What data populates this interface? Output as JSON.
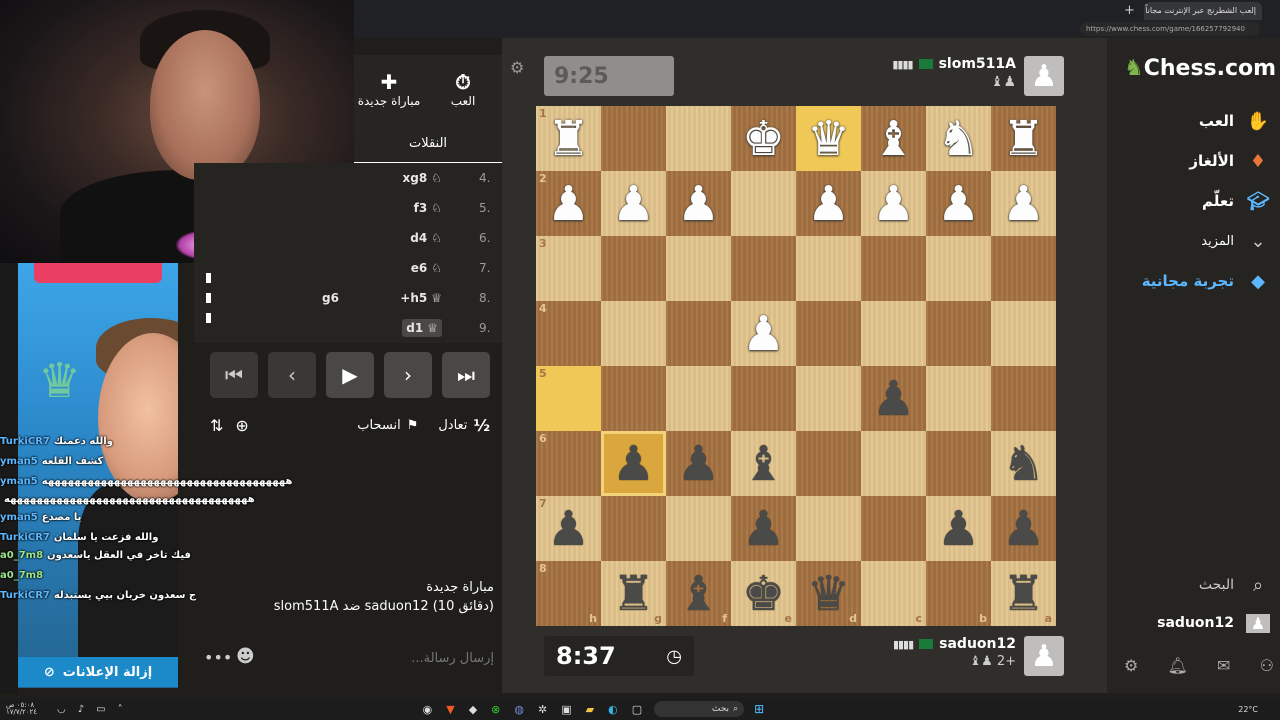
{
  "browser": {
    "tab_title": "إلعب الشطرنج عبر الإنترنت مجاناً - ش",
    "url": "https://www.chess.com/game/166257792940",
    "new_tab": "+"
  },
  "stream": {
    "ad_remove_label": "إزالة الإعلانات",
    "chat": [
      {
        "user": "TurkiCR7",
        "text": "والله دعمنك",
        "color": "blue"
      },
      {
        "user": "yman5",
        "text": "كشف القلعه",
        "color": "blue"
      },
      {
        "user": "yman5",
        "text": "هههههههههههههههههههههههههههههههههههههه",
        "color": "blue"
      },
      {
        "user": "",
        "text": "هههههههههههههههههههههههههههههههههههههه",
        "color": "blue"
      },
      {
        "user": "yman5",
        "text": "يا مصدع",
        "color": "blue"
      },
      {
        "user": "TurkiCR7",
        "text": "والله فزعت يا سلمان",
        "color": "blue"
      },
      {
        "user": "a0_7m8",
        "text": "فيك تاخر في العقل ياسعدون",
        "color": "green"
      },
      {
        "user": "a0_7m8",
        "text": "",
        "color": "green"
      },
      {
        "user": "TurkiCR7",
        "text": "ج سعدون خربان بيي يستبدله",
        "color": "blue"
      }
    ]
  },
  "game_panel": {
    "play_label": "العب",
    "new_game_label": "مباراة جديدة",
    "moves_tab": "النقلات",
    "moves": [
      {
        "num": "4.",
        "white": "xg8",
        "black": ""
      },
      {
        "num": "5.",
        "white": "f3",
        "black": ""
      },
      {
        "num": "6.",
        "white": "d4",
        "black": ""
      },
      {
        "num": "7.",
        "white": "e6",
        "black": ""
      },
      {
        "num": "8.",
        "white": "+h5",
        "black": "g6"
      },
      {
        "num": "9.",
        "white": "d1",
        "black": ""
      }
    ],
    "draw_label": "تعادل",
    "resign_label": "انسحاب",
    "draw_symbol": "½",
    "game_title": "مباراة جديدة",
    "game_desc": "slom511A ضد saduon12 (10 دقائق)",
    "chat_placeholder": "إرسال رسالة..."
  },
  "board": {
    "top_player": "slom511A",
    "bottom_player": "saduon12",
    "top_clock": "9:25",
    "bottom_clock": "8:37",
    "bottom_material": "2+",
    "ranks": [
      "1",
      "2",
      "3",
      "4",
      "5",
      "6",
      "7",
      "8"
    ],
    "files": [
      "h",
      "g",
      "f",
      "e",
      "d",
      "c",
      "b",
      "a"
    ],
    "rows": [
      [
        "wR",
        "",
        "",
        "wK",
        "wQ",
        "wB",
        "wN",
        "wR"
      ],
      [
        "wP",
        "wP",
        "wP",
        "",
        "wP",
        "wP",
        "wP",
        "wP"
      ],
      [
        "",
        "",
        "",
        "",
        "",
        "",
        "",
        ""
      ],
      [
        "",
        "",
        "",
        "wP",
        "",
        "",
        "",
        ""
      ],
      [
        "",
        "",
        "",
        "",
        "",
        "bP",
        "",
        ""
      ],
      [
        "",
        "bP",
        "bP",
        "bB",
        "",
        "",
        "",
        "bN"
      ],
      [
        "bP",
        "",
        "",
        "bP",
        "",
        "",
        "bP",
        "bP"
      ],
      [
        "",
        "bR",
        "bB",
        "bK",
        "bQ",
        "",
        "",
        "bR"
      ]
    ],
    "highlight_squares": [
      [
        0,
        4
      ],
      [
        4,
        0
      ]
    ],
    "selected_square": [
      5,
      1
    ]
  },
  "nav": {
    "logo": "Chess.com",
    "items": [
      {
        "label": "العب",
        "icon": "pawn-hand-icon"
      },
      {
        "label": "الألغاز",
        "icon": "puzzle-icon"
      },
      {
        "label": "تعلّم",
        "icon": "graduation-cap-icon"
      },
      {
        "label": "المزيد",
        "icon": "chevron-down-icon"
      }
    ],
    "free_trial": "تجربة مجانية",
    "search": "البحث",
    "username": "saduon12"
  },
  "taskbar": {
    "search": "بحث",
    "weather": "22°C",
    "time": "٠٥:٠٨ ص",
    "date": "١٧/٧/٢٠٢٤"
  }
}
